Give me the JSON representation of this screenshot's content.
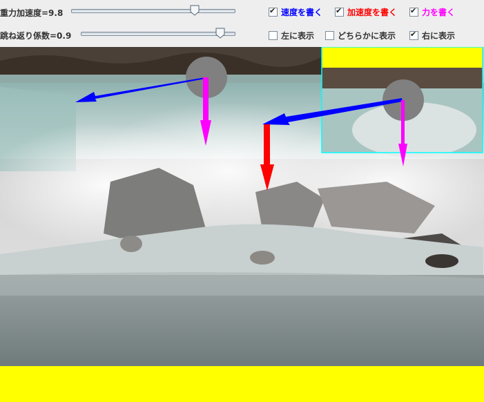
{
  "controls": {
    "gravity_label": "重力加速度=9.8",
    "gravity_fraction": 0.75,
    "restitution_label": "跳ね返り係数=0.9",
    "restitution_fraction": 0.9
  },
  "options": [
    {
      "label": "速度を書く",
      "checked": true,
      "color": "#0000ff"
    },
    {
      "label": "加速度を書く",
      "checked": true,
      "color": "#ff0000"
    },
    {
      "label": "力を書く",
      "checked": true,
      "color": "#ff00ff"
    }
  ],
  "display": [
    {
      "label": "左に表示",
      "checked": false
    },
    {
      "label": "どちらかに表示",
      "checked": false
    },
    {
      "label": "右に表示",
      "checked": true
    }
  ],
  "colors": {
    "velocity": "#0000ff",
    "acceleration": "#ff0000",
    "force": "#ff00ff",
    "ball": "#808080",
    "floor": "#ffff00",
    "inset_border": "#00ffff"
  }
}
